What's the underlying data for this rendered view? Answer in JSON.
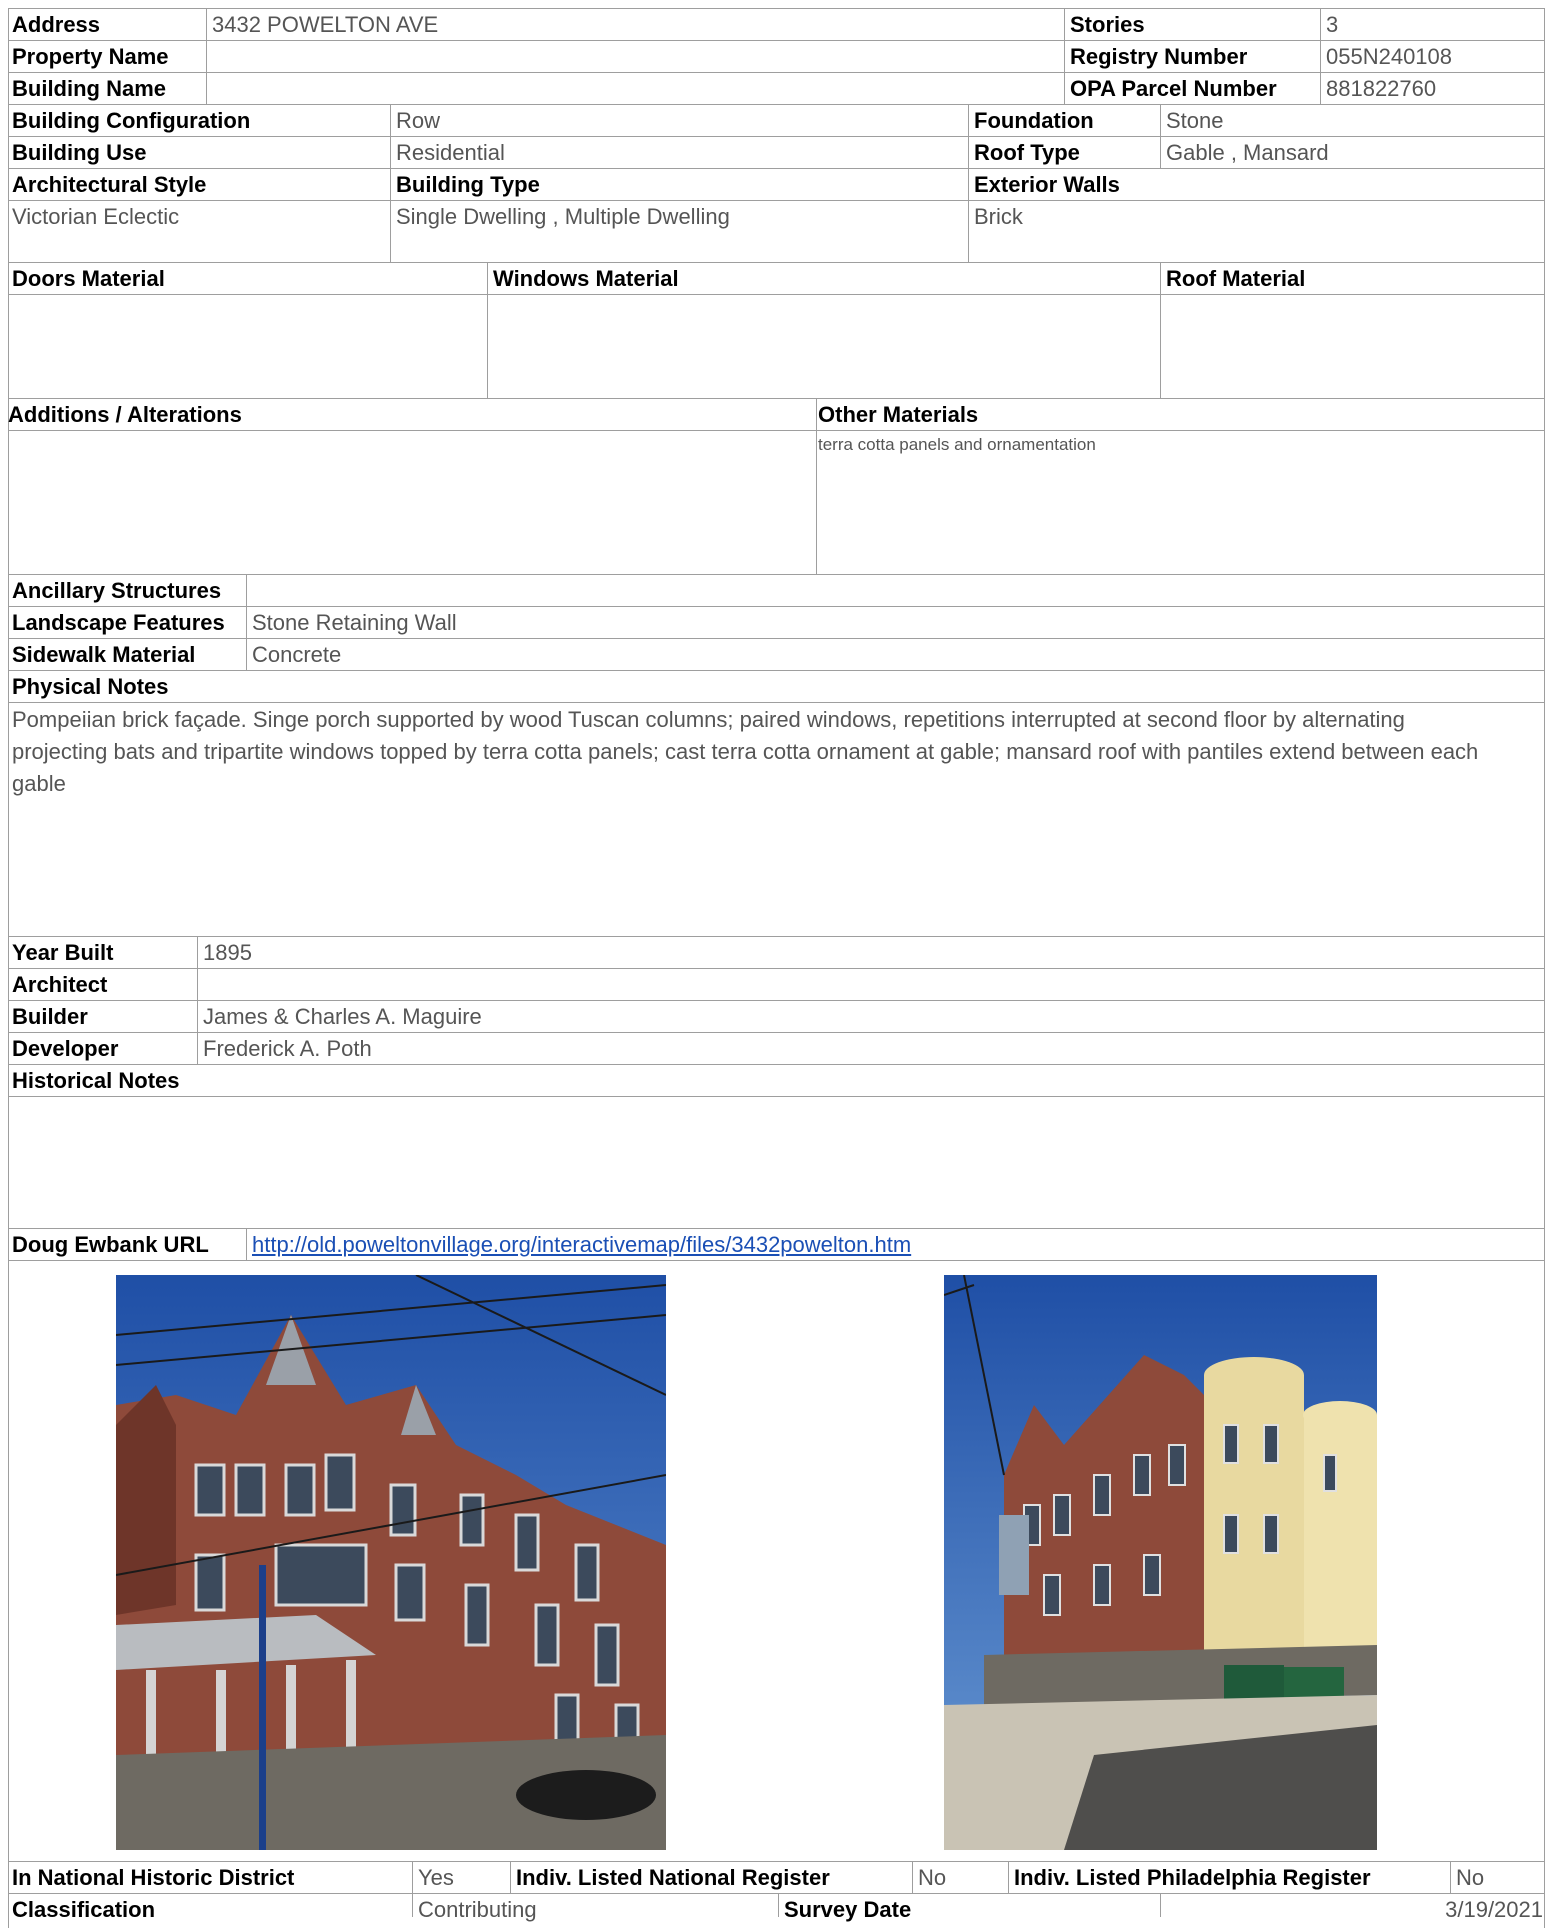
{
  "rows": {
    "address": {
      "label": "Address",
      "value": "3432 POWELTON AVE"
    },
    "stories": {
      "label": "Stories",
      "value": "3"
    },
    "property_name": {
      "label": "Property Name",
      "value": ""
    },
    "registry_number": {
      "label": "Registry Number",
      "value": "055N240108"
    },
    "building_name": {
      "label": "Building Name",
      "value": ""
    },
    "opa_parcel": {
      "label": "OPA Parcel Number",
      "value": "881822760"
    },
    "configuration": {
      "label": "Building Configuration",
      "value": "Row"
    },
    "foundation": {
      "label": "Foundation",
      "value": "Stone"
    },
    "use": {
      "label": "Building Use",
      "value": "Residential"
    },
    "roof_type": {
      "label": "Roof Type",
      "value": "Gable , Mansard"
    },
    "arch_style": {
      "label": "Architectural Style",
      "value": "Victorian Eclectic"
    },
    "building_type": {
      "label": "Building Type",
      "value": "Single Dwelling , Multiple Dwelling"
    },
    "exterior_walls": {
      "label": "Exterior Walls",
      "value": "Brick"
    },
    "doors": {
      "label": "Doors Material",
      "value": ""
    },
    "windows": {
      "label": "Windows Material",
      "value": ""
    },
    "roof_material": {
      "label": "Roof Material",
      "value": ""
    },
    "additions": {
      "label": "Additions / Alterations",
      "value": ""
    },
    "other_materials": {
      "label": "Other Materials",
      "value": "terra cotta panels and ornamentation"
    },
    "ancillary": {
      "label": "Ancillary Structures",
      "value": ""
    },
    "landscape": {
      "label": "Landscape Features",
      "value": "Stone Retaining Wall"
    },
    "sidewalk": {
      "label": "Sidewalk Material",
      "value": "Concrete"
    },
    "physical_notes": {
      "label": "Physical Notes",
      "value": "Pompeiian brick façade. Singe porch supported by wood Tuscan columns; paired windows, repetitions interrupted at second floor by alternating projecting bats and tripartite windows topped by terra cotta panels; cast terra cotta ornament at gable; mansard roof with pantiles extend between each gable"
    },
    "year_built": {
      "label": "Year Built",
      "value": "1895"
    },
    "architect": {
      "label": "Architect",
      "value": ""
    },
    "builder": {
      "label": "Builder",
      "value": "James & Charles A. Maguire"
    },
    "developer": {
      "label": "Developer",
      "value": "Frederick A. Poth"
    },
    "historical_notes": {
      "label": "Historical Notes",
      "value": ""
    },
    "ewbank_url": {
      "label": "Doug Ewbank URL",
      "value": "http://old.poweltonvillage.org/interactivemap/files/3432powelton.htm"
    },
    "national_district": {
      "label": "In National Historic District",
      "value": "Yes"
    },
    "national_register": {
      "label": "Indiv. Listed National Register",
      "value": "No"
    },
    "phila_register": {
      "label": "Indiv. Listed Philadelphia Register",
      "value": "No"
    },
    "classification": {
      "label": "Classification",
      "value": "Contributing"
    },
    "survey_date": {
      "label": "Survey Date",
      "value": "3/19/2021"
    }
  },
  "colors": {
    "sky": "#2f5fae",
    "brick": "#8e4a3a",
    "stone": "#6e6a62",
    "cream": "#e8d9a0",
    "link": "#1a4fb5"
  }
}
